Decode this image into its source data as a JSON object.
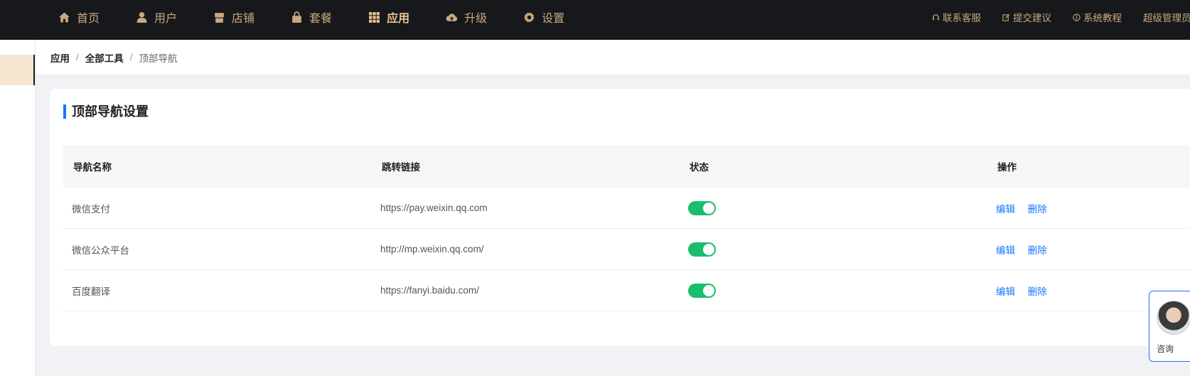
{
  "nav": {
    "items": [
      {
        "label": "首页",
        "icon": "home-icon"
      },
      {
        "label": "用户",
        "icon": "user-icon"
      },
      {
        "label": "店铺",
        "icon": "store-icon"
      },
      {
        "label": "套餐",
        "icon": "bag-icon"
      },
      {
        "label": "应用",
        "icon": "grid-icon",
        "active": true
      },
      {
        "label": "升级",
        "icon": "cloud-upload-icon"
      },
      {
        "label": "设置",
        "icon": "gear-icon"
      }
    ],
    "links": [
      {
        "label": "联系客服",
        "icon": "headset-icon"
      },
      {
        "label": "提交建议",
        "icon": "edit-icon"
      },
      {
        "label": "系统教程",
        "icon": "info-icon"
      },
      {
        "label": "超级管理员"
      }
    ]
  },
  "breadcrumb": [
    "应用",
    "全部工具",
    "顶部导航"
  ],
  "card": {
    "title": "顶部导航设置",
    "table": {
      "columns": [
        "导航名称",
        "跳转链接",
        "状态",
        "操作"
      ],
      "rows": [
        {
          "name": "微信支付",
          "link": "https://pay.weixin.qq.com",
          "enabled": true
        },
        {
          "name": "微信公众平台",
          "link": "http://mp.weixin.qq.com/",
          "enabled": true
        },
        {
          "name": "百度翻译",
          "link": "https://fanyi.baidu.com/",
          "enabled": true
        }
      ],
      "actions": {
        "edit": "编辑",
        "delete": "删除"
      }
    }
  },
  "consult": {
    "label": "咨询"
  },
  "colors": {
    "topbar": "#17181c",
    "nav_text": "#c9a97e",
    "accent": "#1677ff",
    "toggle_on": "#19be6b"
  }
}
